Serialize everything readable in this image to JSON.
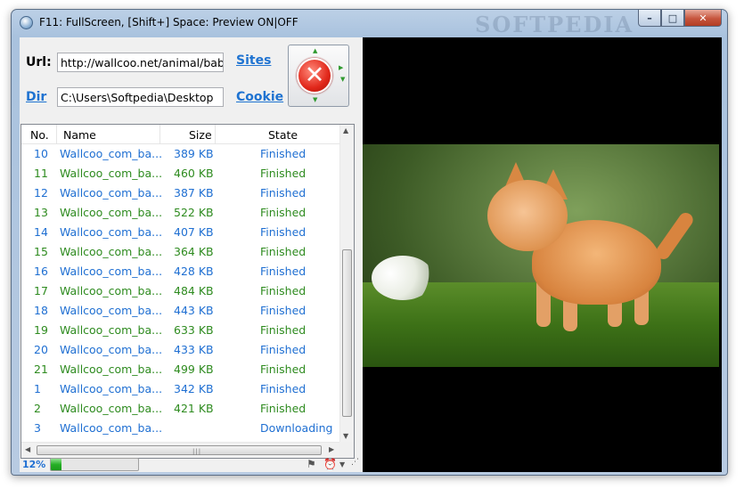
{
  "window": {
    "title": "F11: FullScreen,  [Shift+] Space: Preview ON|OFF",
    "watermark": "SOFTPEDIA",
    "controls": {
      "minimize": "–",
      "maximize": "□",
      "close": "✕"
    }
  },
  "form": {
    "url_label": "Url:",
    "url_value": "http://wallcoo.net/animal/baby_",
    "sites_link": "Sites",
    "dir_label": "Dir",
    "dir_value": "C:\\Users\\Softpedia\\Desktop",
    "cookie_link": "Cookie",
    "stop_button_icon": "stop-x-icon"
  },
  "list": {
    "columns": {
      "no": "No.",
      "name": "Name",
      "size": "Size",
      "state": "State"
    },
    "rows": [
      {
        "no": "10",
        "name": "Wallcoo_com_ba...",
        "size": "389 KB",
        "state": "Finished",
        "color": "blue"
      },
      {
        "no": "11",
        "name": "Wallcoo_com_ba...",
        "size": "460 KB",
        "state": "Finished",
        "color": "green"
      },
      {
        "no": "12",
        "name": "Wallcoo_com_ba...",
        "size": "387 KB",
        "state": "Finished",
        "color": "blue"
      },
      {
        "no": "13",
        "name": "Wallcoo_com_ba...",
        "size": "522 KB",
        "state": "Finished",
        "color": "green"
      },
      {
        "no": "14",
        "name": "Wallcoo_com_ba...",
        "size": "407 KB",
        "state": "Finished",
        "color": "blue"
      },
      {
        "no": "15",
        "name": "Wallcoo_com_ba...",
        "size": "364 KB",
        "state": "Finished",
        "color": "green"
      },
      {
        "no": "16",
        "name": "Wallcoo_com_ba...",
        "size": "428 KB",
        "state": "Finished",
        "color": "blue"
      },
      {
        "no": "17",
        "name": "Wallcoo_com_ba...",
        "size": "484 KB",
        "state": "Finished",
        "color": "green"
      },
      {
        "no": "18",
        "name": "Wallcoo_com_ba...",
        "size": "443 KB",
        "state": "Finished",
        "color": "blue"
      },
      {
        "no": "19",
        "name": "Wallcoo_com_ba...",
        "size": "633 KB",
        "state": "Finished",
        "color": "green"
      },
      {
        "no": "20",
        "name": "Wallcoo_com_ba...",
        "size": "433 KB",
        "state": "Finished",
        "color": "blue"
      },
      {
        "no": "21",
        "name": "Wallcoo_com_ba...",
        "size": "499 KB",
        "state": "Finished",
        "color": "green"
      },
      {
        "no": "1",
        "name": "Wallcoo_com_ba...",
        "size": "342 KB",
        "state": "Finished",
        "color": "blue"
      },
      {
        "no": "2",
        "name": "Wallcoo_com_ba...",
        "size": "421 KB",
        "state": "Finished",
        "color": "green"
      },
      {
        "no": "3",
        "name": "Wallcoo_com_ba...",
        "size": "",
        "state": "Downloading",
        "color": "blue"
      }
    ]
  },
  "status": {
    "percent": "12%",
    "progress_fraction": 0.12
  },
  "colors": {
    "blue_row": "#1f6fd2",
    "green_row": "#2e8b1f",
    "link": "#1f73d1"
  }
}
